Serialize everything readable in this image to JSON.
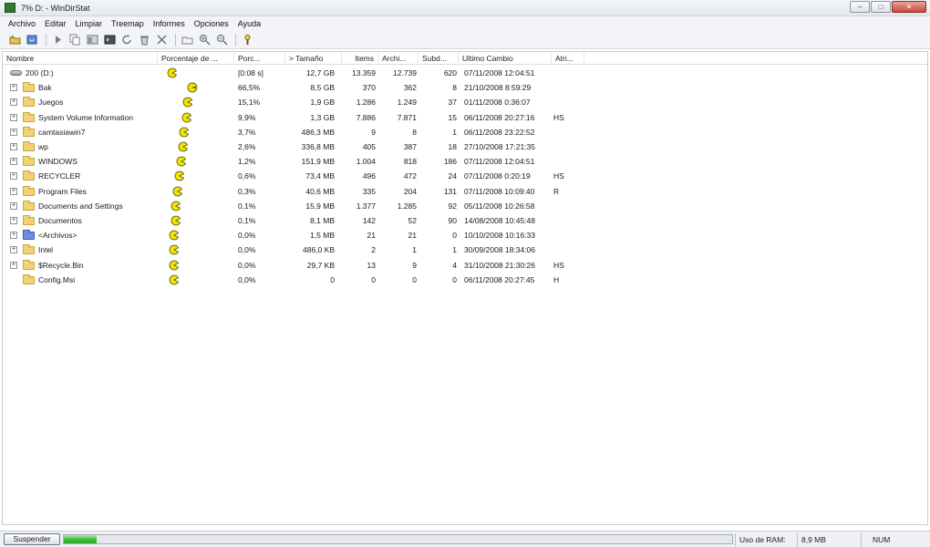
{
  "window": {
    "title": "7% D: - WinDirStat"
  },
  "menu": [
    "Archivo",
    "Editar",
    "Limpiar",
    "Treemap",
    "Informes",
    "Opciones",
    "Ayuda"
  ],
  "toolbar": [
    "open-folder-icon",
    "refresh-icon",
    "play-icon",
    "copy-icon",
    "explorer-icon",
    "command-prompt-icon",
    "undo-icon",
    "recycle-icon",
    "delete-icon",
    "new-folder-icon",
    "zoom-in-icon",
    "zoom-out-icon",
    "help-icon"
  ],
  "columns": {
    "name": "Nombre",
    "percent_bar": "Porcentaje de ...",
    "percent": "Porc...",
    "size": "> Tamaño",
    "items": "Items",
    "files": "Archi...",
    "subdirs": "Subd...",
    "last_change": "Ultimo Cambio",
    "attributes": "Atri..."
  },
  "rows": [
    {
      "type": "drive",
      "name": "200 (D:)",
      "pacman_fill": 0.07,
      "percent": "[0:08 s]",
      "size": "12,7 GB",
      "items": "13.359",
      "files": "12.739",
      "subdirs": "620",
      "last_change": "07/11/2008 12:04:51",
      "attributes": "",
      "expander": false
    },
    {
      "type": "folder",
      "name": "Bak",
      "pacman_fill": 0.665,
      "percent": "66,5%",
      "size": "8,5 GB",
      "items": "370",
      "files": "362",
      "subdirs": "8",
      "last_change": "21/10/2008 8:59:29",
      "attributes": "",
      "expander": true
    },
    {
      "type": "folder",
      "name": "Juegos",
      "pacman_fill": 0.151,
      "percent": "15,1%",
      "size": "1,9 GB",
      "items": "1.286",
      "files": "1.249",
      "subdirs": "37",
      "last_change": "01/11/2008 0:36:07",
      "attributes": "",
      "expander": true
    },
    {
      "type": "folder",
      "name": "System Volume Information",
      "pacman_fill": 0.099,
      "percent": "9,9%",
      "size": "1,3 GB",
      "items": "7.886",
      "files": "7.871",
      "subdirs": "15",
      "last_change": "06/11/2008 20:27:16",
      "attributes": "HS",
      "expander": true
    },
    {
      "type": "folder",
      "name": "camtasiawin7",
      "pacman_fill": 0.037,
      "percent": "3,7%",
      "size": "486,3 MB",
      "items": "9",
      "files": "8",
      "subdirs": "1",
      "last_change": "06/11/2008 23:22:52",
      "attributes": "",
      "expander": true
    },
    {
      "type": "folder",
      "name": "wp",
      "pacman_fill": 0.026,
      "percent": "2,6%",
      "size": "336,8 MB",
      "items": "405",
      "files": "387",
      "subdirs": "18",
      "last_change": "27/10/2008 17:21:35",
      "attributes": "",
      "expander": true
    },
    {
      "type": "folder",
      "name": "WINDOWS",
      "pacman_fill": 0.012,
      "percent": "1,2%",
      "size": "151,9 MB",
      "items": "1.004",
      "files": "818",
      "subdirs": "186",
      "last_change": "07/11/2008 12:04:51",
      "attributes": "",
      "expander": true
    },
    {
      "type": "folder",
      "name": "RECYCLER",
      "pacman_fill": 0.006,
      "percent": "0,6%",
      "size": "73,4 MB",
      "items": "496",
      "files": "472",
      "subdirs": "24",
      "last_change": "07/11/2008 0:20:19",
      "attributes": "HS",
      "expander": true
    },
    {
      "type": "folder",
      "name": "Program Files",
      "pacman_fill": 0.003,
      "percent": "0,3%",
      "size": "40,6 MB",
      "items": "335",
      "files": "204",
      "subdirs": "131",
      "last_change": "07/11/2008 10:09:40",
      "attributes": "R",
      "expander": true
    },
    {
      "type": "folder",
      "name": "Documents and Settings",
      "pacman_fill": 0.001,
      "percent": "0,1%",
      "size": "15,9 MB",
      "items": "1.377",
      "files": "1.285",
      "subdirs": "92",
      "last_change": "05/11/2008 10:26:58",
      "attributes": "",
      "expander": true
    },
    {
      "type": "folder",
      "name": "Documentos",
      "pacman_fill": 0.001,
      "percent": "0,1%",
      "size": "8,1 MB",
      "items": "142",
      "files": "52",
      "subdirs": "90",
      "last_change": "14/08/2008 10:45:48",
      "attributes": "",
      "expander": true
    },
    {
      "type": "files",
      "name": "<Archivos>",
      "pacman_fill": 0,
      "percent": "0,0%",
      "size": "1,5 MB",
      "items": "21",
      "files": "21",
      "subdirs": "0",
      "last_change": "10/10/2008 10:16:33",
      "attributes": "",
      "expander": true
    },
    {
      "type": "folder",
      "name": "Intel",
      "pacman_fill": 0,
      "percent": "0,0%",
      "size": "486,0 KB",
      "items": "2",
      "files": "1",
      "subdirs": "1",
      "last_change": "30/09/2008 18:34:06",
      "attributes": "",
      "expander": true
    },
    {
      "type": "folder",
      "name": "$Recycle.Bin",
      "pacman_fill": 0,
      "percent": "0,0%",
      "size": "29,7 KB",
      "items": "13",
      "files": "9",
      "subdirs": "4",
      "last_change": "31/10/2008 21:30:26",
      "attributes": "HS",
      "expander": true
    },
    {
      "type": "folder",
      "name": "Config.Msi",
      "pacman_fill": 0,
      "percent": "0,0%",
      "size": "0",
      "items": "0",
      "files": "0",
      "subdirs": "0",
      "last_change": "06/11/2008 20:27:45",
      "attributes": "H",
      "expander": false
    }
  ],
  "status": {
    "suspend_label": "Suspender",
    "progress": 0.07,
    "ram_label": "Uso de RAM:",
    "ram_value": "8,9 MB",
    "num": "NUM"
  },
  "colors": {
    "pacman": "#f0e400",
    "progress": "#3fc43a"
  }
}
